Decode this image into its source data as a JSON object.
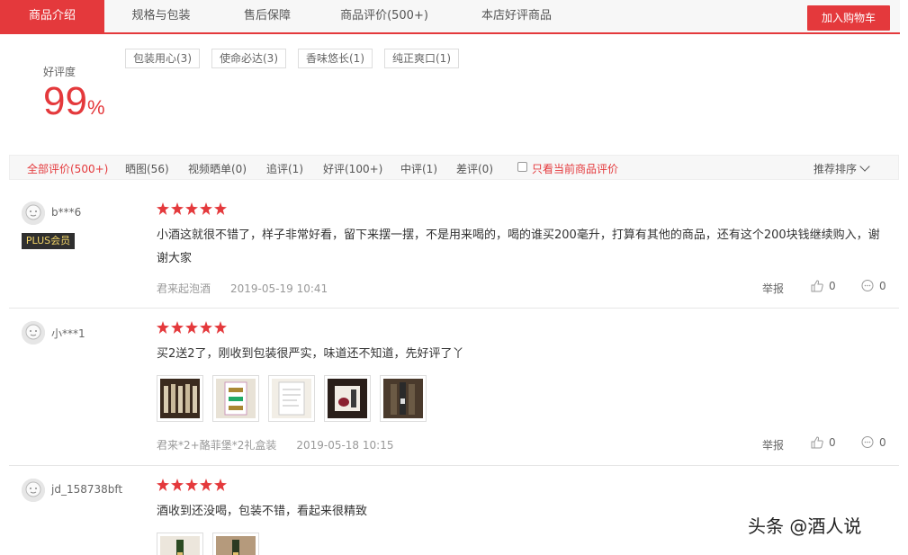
{
  "tabs": [
    {
      "label": "商品介绍",
      "active": true
    },
    {
      "label": "规格与包装"
    },
    {
      "label": "售后保障"
    },
    {
      "label": "商品评价(500+)"
    },
    {
      "label": "本店好评商品"
    }
  ],
  "cart_button": "加入购物车",
  "summary": {
    "rate_label": "好评度",
    "rate_value": "99",
    "rate_unit": "%",
    "tags": [
      "包装用心(3)",
      "使命必达(3)",
      "香味悠长(1)",
      "纯正爽口(1)"
    ]
  },
  "filters": {
    "items": [
      "全部评价(500+)",
      "晒图(56)",
      "视频晒单(0)",
      "追评(1)",
      "好评(100+)",
      "中评(1)",
      "差评(0)"
    ],
    "only_current_label": "只看当前商品评价",
    "sort_label": "推荐排序"
  },
  "reviews": [
    {
      "user": "b***6",
      "badge": "PLUS会员",
      "stars": 5,
      "text": "小酒这就很不错了，样子非常好看，留下来摆一摆，不是用来喝的，喝的谁买200毫升，打算有其他的商品，还有这个200块钱继续购入，谢谢大家",
      "product": "君来起泡酒",
      "date": "2019-05-19 10:41",
      "report": "举报",
      "likes": "0",
      "replies": "0"
    },
    {
      "user": "小***1",
      "stars": 5,
      "text": "买2送2了，刚收到包装很严实，味道还不知道，先好评了丫",
      "product": "君来*2+酪菲堡*2礼盒装",
      "date": "2019-05-18 10:15",
      "report": "举报",
      "likes": "0",
      "replies": "0"
    },
    {
      "user": "jd_158738bft",
      "stars": 5,
      "text": "酒收到还没喝，包装不错，看起来很精致"
    }
  ],
  "watermark": "头条 @酒人说",
  "colors": {
    "accent": "#e4393c",
    "plus_bg": "#2f2f2f",
    "plus_text": "#f4d668"
  }
}
